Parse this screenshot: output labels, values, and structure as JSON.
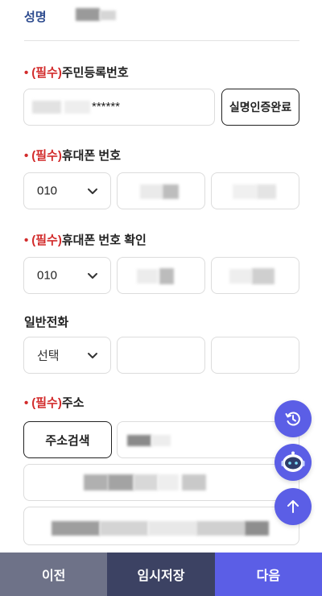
{
  "name": {
    "label": "성명"
  },
  "rrn": {
    "bullet": "•",
    "required": "(필수)",
    "label": "주민등록번호",
    "masked": "******",
    "verify_button": "실명인증완료"
  },
  "phone": {
    "bullet": "•",
    "required": "(필수)",
    "label": "휴대폰 번호",
    "prefix": "010"
  },
  "phone_confirm": {
    "bullet": "•",
    "required": "(필수)",
    "label": "휴대폰 번호 확인",
    "prefix": "010"
  },
  "landline": {
    "label": "일반전화",
    "prefix": "선택"
  },
  "address": {
    "bullet": "•",
    "required": "(필수)",
    "label": "주소",
    "search_button": "주소검색"
  },
  "floating": {
    "history_icon": "history-icon",
    "chatbot_icon": "chatbot-icon",
    "top_icon": "arrow-up-icon",
    "accent": "#5b5ee6"
  },
  "footer": {
    "prev": "이전",
    "save": "임시저장",
    "next": "다음",
    "colors": {
      "prev": "#6e7288",
      "save": "#3c4263",
      "next": "#5b5ee6"
    }
  }
}
